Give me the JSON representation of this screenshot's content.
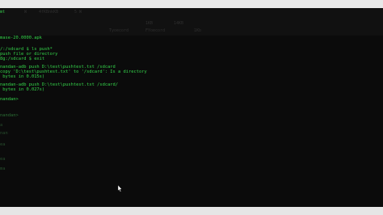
{
  "header": {
    "menu": [
      "mt",
      "W",
      "4fKBnkKB",
      "5 W"
    ],
    "right": [
      "1KB",
      "14KB"
    ],
    "sub_right": [
      "Tyoecord",
      "FYoecord",
      "1Kb"
    ]
  },
  "lines": [
    {
      "text": "mase-20.0000.apk",
      "row": 0
    },
    {
      "text": "/:/sdcard $ ls push*",
      "row": 2
    },
    {
      "text": "push file or directory",
      "row": 3
    },
    {
      "text": "8g:/sdcard $ exit",
      "row": 4
    },
    {
      "text": "nandan-adb push D:\\test\\pushtest.txt /sdcard",
      "row": 6
    },
    {
      "text": "copy 'D:\\test\\pushtest.txt' to '/sdcard': Is a directory",
      "row": 7
    },
    {
      "text": " bytes in 0.015s)",
      "row": 8
    },
    {
      "text": "nandan-adb push D:\\test\\pushtest.txt /sdcard/",
      "row": 10
    },
    {
      "text": " bytes in 0.027s)",
      "row": 11
    },
    {
      "text": "nandan>",
      "row": 13
    }
  ],
  "faint_lines": [
    {
      "text": "nandan>",
      "row": 18
    },
    {
      "text": "",
      "row": 20
    },
    {
      "text": "a",
      "row": 22
    },
    {
      "text": "nan",
      "row": 24
    },
    {
      "text": "",
      "row": 27
    },
    {
      "text": "ea",
      "row": 29
    },
    {
      "text": "",
      "row": 31
    },
    {
      "text": "ea",
      "row": 32
    },
    {
      "text": "",
      "row": 33
    },
    {
      "text": "ma",
      "row": 34
    },
    {
      "text": "",
      "row": 36
    }
  ]
}
